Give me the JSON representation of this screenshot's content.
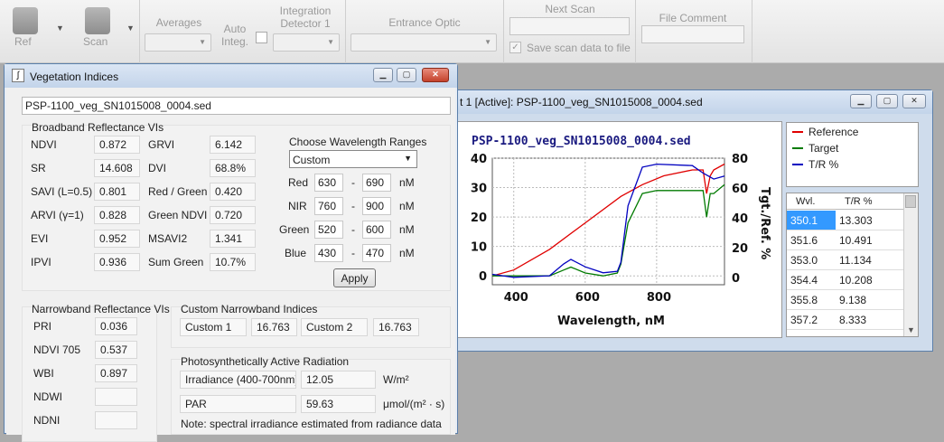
{
  "toolbar": {
    "ref_label": "Ref",
    "scan_label": "Scan",
    "averages_label": "Averages",
    "auto_integ_label": "Auto\nInteg.",
    "integration_label": "Integration\nDetector 1",
    "entrance_optic_label": "Entrance Optic",
    "next_scan_label": "Next Scan",
    "save_scan_label": "Save scan data to file",
    "file_comment_label": "File Comment"
  },
  "veg_window": {
    "title": "Vegetation Indices",
    "filename": "PSP-1100_veg_SN1015008_0004.sed",
    "broadband": {
      "title": "Broadband Reflectance VIs",
      "rows": [
        {
          "l1": "NDVI",
          "v1": "0.872",
          "l2": "GRVI",
          "v2": "6.142"
        },
        {
          "l1": "SR",
          "v1": "14.608",
          "l2": "DVI",
          "v2": "68.8%"
        },
        {
          "l1": "SAVI (L=0.5)",
          "v1": "0.801",
          "l2": "Red / Green",
          "v2": "0.420"
        },
        {
          "l1": "ARVI (γ=1)",
          "v1": "0.828",
          "l2": "Green NDVI",
          "v2": "0.720"
        },
        {
          "l1": "EVI",
          "v1": "0.952",
          "l2": "MSAVI2",
          "v2": "1.341"
        },
        {
          "l1": "IPVI",
          "v1": "0.936",
          "l2": "Sum Green",
          "v2": "10.7%"
        }
      ]
    },
    "ranges": {
      "title": "Choose Wavelength Ranges",
      "selected": "Custom",
      "unit": "nM",
      "dash": "-",
      "rows": [
        {
          "label": "Red",
          "from": "630",
          "to": "690"
        },
        {
          "label": "NIR",
          "from": "760",
          "to": "900"
        },
        {
          "label": "Green",
          "from": "520",
          "to": "600"
        },
        {
          "label": "Blue",
          "from": "430",
          "to": "470"
        }
      ],
      "apply_label": "Apply"
    },
    "narrowband": {
      "title": "Narrowband Reflectance VIs",
      "rows": [
        {
          "label": "PRI",
          "value": "0.036"
        },
        {
          "label": "NDVI 705",
          "value": "0.537"
        },
        {
          "label": "WBI",
          "value": "0.897"
        },
        {
          "label": "NDWI",
          "value": ""
        },
        {
          "label": "NDNI",
          "value": ""
        }
      ]
    },
    "custom_nb": {
      "title": "Custom Narrowband Indices",
      "c1_label": "Custom 1",
      "c1_value": "16.763",
      "c2_label": "Custom 2",
      "c2_value": "16.763"
    },
    "par": {
      "title": "Photosynthetically Active Radiation",
      "irr_label": "Irradiance (400-700nm)",
      "irr_value": "12.05",
      "irr_unit": "W/m²",
      "par_label": "PAR",
      "par_value": "59.63",
      "par_unit": "μmol/(m² · s)",
      "note": "Note: spectral irradiance estimated from radiance data"
    }
  },
  "plot_window": {
    "title": "t 1 [Active]: PSP-1100_veg_SN1015008_0004.sed",
    "legend": [
      "Reference",
      "Target",
      "T/R %"
    ],
    "table_headers": [
      "Wvl.",
      "T/R %"
    ],
    "table_rows": [
      [
        "350.1",
        "13.303"
      ],
      [
        "351.6",
        "10.491"
      ],
      [
        "353.0",
        "11.134"
      ],
      [
        "354.4",
        "10.208"
      ],
      [
        "355.8",
        "9.138"
      ],
      [
        "357.2",
        "8.333"
      ]
    ]
  },
  "chart_data": {
    "type": "line",
    "title": "PSP-1100_veg_SN1015008_0004.sed",
    "xlabel": "Wavelength, nM",
    "ylabel_right": "Tgt./Ref. %",
    "xlim": [
      340,
      990
    ],
    "ylim_left": [
      -3,
      40
    ],
    "ylim_right": [
      -5,
      80
    ],
    "x_ticks": [
      400,
      600,
      800
    ],
    "y_ticks_left": [
      0,
      10,
      20,
      30,
      40
    ],
    "y_ticks_right": [
      0,
      20,
      40,
      60,
      80
    ],
    "grid": true,
    "series": [
      {
        "name": "Reference",
        "color": "#e00000",
        "axis": "left",
        "x": [
          340,
          400,
          500,
          600,
          700,
          760,
          820,
          900,
          930,
          940,
          950,
          960,
          990
        ],
        "y": [
          0,
          2,
          9,
          18,
          27,
          31,
          34,
          36,
          36,
          28,
          34,
          36,
          38
        ]
      },
      {
        "name": "Target",
        "color": "#007a00",
        "axis": "left",
        "x": [
          340,
          400,
          500,
          540,
          560,
          600,
          650,
          690,
          700,
          720,
          760,
          800,
          900,
          930,
          940,
          950,
          960,
          990
        ],
        "y": [
          0,
          0,
          0,
          2,
          3,
          1,
          0,
          1,
          4,
          18,
          28,
          29,
          29,
          29,
          20,
          28,
          28,
          31
        ]
      },
      {
        "name": "T/R %",
        "color": "#0000c0",
        "axis": "right",
        "x": [
          340,
          400,
          500,
          540,
          560,
          600,
          650,
          690,
          700,
          720,
          760,
          800,
          900,
          930,
          960,
          990
        ],
        "y": [
          2,
          0,
          1,
          9,
          12,
          7,
          3,
          4,
          10,
          48,
          74,
          76,
          75,
          70,
          66,
          68
        ]
      }
    ]
  }
}
